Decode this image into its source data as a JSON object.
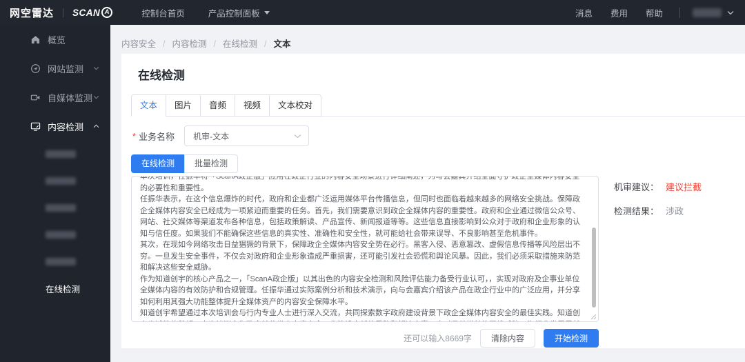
{
  "colors": {
    "accent": "#2e7cf0",
    "danger": "#f04134",
    "navbar_bg": "#22262e",
    "sidebar_bg": "#20242c",
    "page_bg": "#f0f2f5"
  },
  "navbar": {
    "brand": "网空雷达",
    "logo_text": "SCAN",
    "logo_badge": "A",
    "console_home": "控制台首页",
    "product_panel": "产品控制面板",
    "messages": "消息",
    "billing": "费用",
    "help": "帮助"
  },
  "sidebar": {
    "items": [
      {
        "label": "概览",
        "icon": "home-icon"
      },
      {
        "label": "网站监测",
        "icon": "website-monitor-icon"
      },
      {
        "label": "自媒体监测",
        "icon": "media-monitor-icon"
      },
      {
        "label": "内容检测",
        "icon": "content-detection-icon"
      }
    ],
    "active_subitem": "在线检测"
  },
  "breadcrumb": {
    "items": [
      "内容安全",
      "内容检测",
      "在线检测",
      "文本"
    ]
  },
  "page": {
    "title": "在线检测"
  },
  "tabs": {
    "items": [
      {
        "label": "文本"
      },
      {
        "label": "图片"
      },
      {
        "label": "音频"
      },
      {
        "label": "视频"
      },
      {
        "label": "文本校对"
      }
    ]
  },
  "form": {
    "required_mark": "*",
    "business_name_label": "业务名称",
    "business_name_value": "机审-文本"
  },
  "modes": {
    "online": "在线检测",
    "batch": "批量检测"
  },
  "content": {
    "text": "本次培训，任振华将「ScanA政企版」应用在政企行业的内容安全场景进行详细阐述，为与会嘉宾介绍全面守护政企全媒体内容安全的必要性和重要性。\n任振华表示，在这个信息爆炸的时代，政府和企业都广泛运用媒体平台传播信息，但同时也面临着越来越多的网络安全挑战。保障政企全媒体内容安全已经成为一项紧迫而重要的任务。首先，我们需要意识到政企全媒体内容的重要性。政府和企业通过微信公众号、网站、社交媒体等渠道发布各种信息，包括政策解读、产品宣传、新闻报道等等。这些信息直接影响到公众对于政府和企业形象的认知与信任度。如果我们不能确保这些信息的真实性、准确性和安全性，就可能给社会带来误导、不良影响甚至危机事件。\n其次，在现如今网络攻击日益猖獗的背景下，保障政企全媒体内容安全势在必行。黑客入侵、恶意篡改、虚假信息传播等风险层出不穷。一旦发生安全事件，不仅会对政府和企业形象造成严重损害，还可能引发社会恐慌和舆论风暴。因此，我们必须采取措施来防范和解决这些安全威胁。\n作为知道创宇的核心产品之一，「ScanA政企版」以其出色的内容安全检测和风险评估能力备受行业认可，，实现对政府及企事业单位全媒体内容的有效防护和合规管理。任振华通过实际案例分析和技术演示，向与会嘉宾介绍该产品在政企行业中的广泛应用，并分享如何利用其强大功能整体提升全媒体资产的内容安全保障水平。\n知道创宇希望通过本次培训会与行内专业人士进行深入交流，共同探索数字政府建设背景下政企全媒体内容安全的最佳实践。知道创宇也诚挚的希望，本次培训会为政企单位带来内容安全工作建设中新的思路和解决方案，应对日益增长的网络威胁，为行业发展贡献力量！"
  },
  "result": {
    "suggestion_label": "机审建议：",
    "suggestion_value": "建议拦截",
    "verdict_label": "检测结果：",
    "verdict_value": "涉政"
  },
  "footer": {
    "remaining": "还可以输入8669字",
    "clear_button": "清除内容",
    "start_button": "开始检测"
  }
}
